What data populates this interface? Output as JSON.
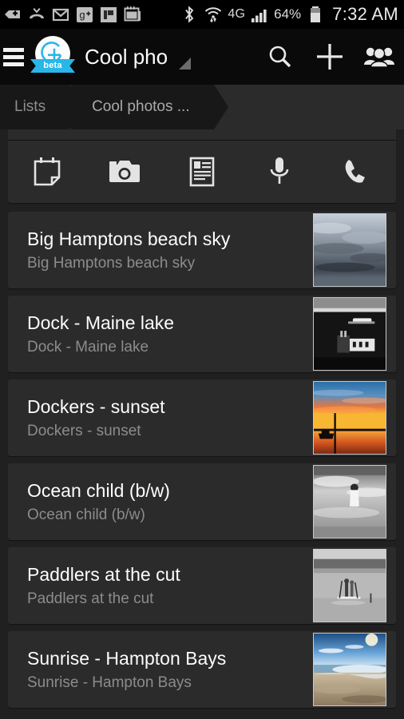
{
  "statusbar": {
    "left_icons": [
      "plus-badge-icon",
      "missed-call-icon",
      "gmail-icon",
      "google-plus-icon",
      "flipboard-icon",
      "calendar-icon"
    ],
    "bluetooth_icon": "bluetooth-icon",
    "wifi_icon": "wifi-icon",
    "network_label": "4G",
    "signal_icon": "signal-bars-icon",
    "battery_percent": "64%",
    "battery_icon": "battery-icon",
    "clock": "7:32 AM"
  },
  "appbar": {
    "menu_icon": "hamburger-menu-icon",
    "logo_icon": "app-logo-icon",
    "logo_badge": "beta",
    "title": "Cool pho",
    "spinner_icon": "dropdown-triangle-icon",
    "search_icon": "search-icon",
    "add_icon": "plus-icon",
    "people_icon": "people-group-icon"
  },
  "breadcrumbs": {
    "items": [
      {
        "label": "Lists"
      },
      {
        "label": "Cool photos ..."
      }
    ]
  },
  "quick_actions": [
    {
      "name": "note-icon",
      "label": "Note"
    },
    {
      "name": "camera-icon",
      "label": "Camera"
    },
    {
      "name": "document-icon",
      "label": "Document"
    },
    {
      "name": "microphone-icon",
      "label": "Voice"
    },
    {
      "name": "phone-icon",
      "label": "Call"
    }
  ],
  "photos": [
    {
      "title": "Big Hamptons beach sky",
      "subtitle": "Big Hamptons beach sky",
      "thumb": "clouds"
    },
    {
      "title": "Dock - Maine lake",
      "subtitle": "Dock - Maine lake",
      "thumb": "dock"
    },
    {
      "title": "Dockers - sunset",
      "subtitle": "Dockers - sunset",
      "thumb": "sunset"
    },
    {
      "title": "Ocean child (b/w)",
      "subtitle": "Ocean child (b/w)",
      "thumb": "oceanchild"
    },
    {
      "title": "Paddlers at the cut",
      "subtitle": "Paddlers at the cut",
      "thumb": "paddlers"
    },
    {
      "title": "Sunrise - Hampton Bays",
      "subtitle": "Sunrise - Hampton Bays",
      "thumb": "sunrisebeach"
    }
  ],
  "colors": {
    "background": "#202020",
    "card": "#2b2b2b",
    "appbar": "#0a0a0a",
    "statusbar": "#000000",
    "accent": "#29b6e8",
    "title_text": "#fdfdfd",
    "subtitle_text": "#8c8c8c"
  }
}
